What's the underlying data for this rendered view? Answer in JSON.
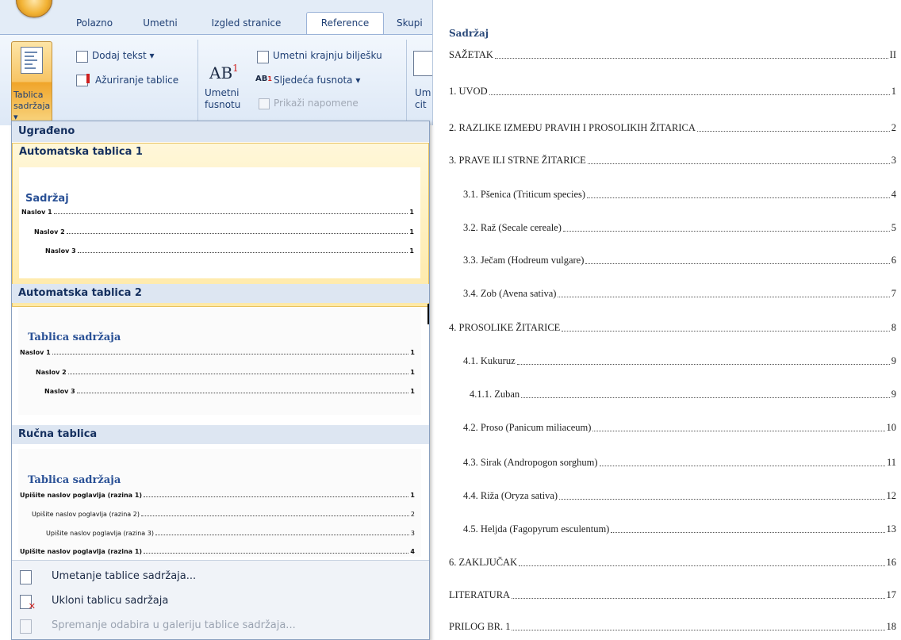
{
  "ribbon": {
    "tabs": [
      "Polazno",
      "Umetni",
      "Izgled stranice",
      "Reference",
      "Skupi"
    ],
    "active_tab": "Reference",
    "toc_button": {
      "line1": "Tablica",
      "line2": "sadržaja ▾"
    },
    "add_text": "Dodaj tekst ▾",
    "update_table": "Ažuriranje tablice",
    "insert_endnote": "Umetni krajnju bilješku",
    "next_footnote": "Sljedeća fusnota ▾",
    "show_notes": "Prikaži napomene",
    "insert_footnote": {
      "line1": "Umetni",
      "line2": "fusnotu"
    },
    "insert_citation": {
      "line1": "Um",
      "line2": "cit"
    },
    "ab_glyph": "AB",
    "ab_sup": "1"
  },
  "dropdown": {
    "builtin_header": "Ugrađeno",
    "items": [
      {
        "name": "Automatska tablica 1",
        "preview_title": "Sadržaj",
        "rows": [
          {
            "text": "Naslov 1",
            "page": "1"
          },
          {
            "text": "Naslov 2",
            "page": "1"
          },
          {
            "text": "Naslov 3",
            "page": "1"
          }
        ]
      },
      {
        "name": "Automatska tablica 2",
        "preview_title": "Tablica sadržaja",
        "rows": [
          {
            "text": "Naslov 1",
            "page": "1"
          },
          {
            "text": "Naslov 2",
            "page": "1"
          },
          {
            "text": "Naslov 3",
            "page": "1"
          }
        ]
      },
      {
        "name": "Ručna tablica",
        "preview_title": "Tablica sadržaja",
        "rows": [
          {
            "text": "Upišite naslov poglavlja (razina 1)",
            "page": "1"
          },
          {
            "text": "Upišite naslov poglavlja (razina 2)",
            "page": "2"
          },
          {
            "text": "Upišite naslov poglavlja (razina 3)",
            "page": "3"
          },
          {
            "text": "Upišite naslov poglavlja (razina 1)",
            "page": "4"
          }
        ]
      }
    ],
    "menu": [
      {
        "label": "Umetanje tablice sadržaja...",
        "enabled": true
      },
      {
        "label": "Ukloni tablicu sadržaja",
        "enabled": true
      },
      {
        "label": "Spremanje odabira u galeriju tablice sadržaja...",
        "enabled": false
      }
    ]
  },
  "document": {
    "title": "Sadržaj",
    "entries": [
      {
        "text": "SAŽETAK",
        "page": "II"
      },
      {
        "text": "1. UVOD",
        "page": "1"
      },
      {
        "text": "2. RAZLIKE IZMEĐU PRAVIH I PROSOLIKIH ŽITARICA",
        "page": "2"
      },
      {
        "text": "3. PRAVE ILI STRNE ŽITARICE",
        "page": "3"
      },
      {
        "text": "3.1. Pšenica  (Triticum species)",
        "page": "4"
      },
      {
        "text": "3.2. Raž (Secale cereale)",
        "page": "5"
      },
      {
        "text": "3.3. Ječam (Hodreum vulgare)",
        "page": "6"
      },
      {
        "text": "3.4. Zob (Avena sativa)",
        "page": "7"
      },
      {
        "text": "4. PROSOLIKE ŽITARICE",
        "page": "8"
      },
      {
        "text": "4.1. Kukuruz",
        "page": "9"
      },
      {
        "text": "4.1.1. Zuban",
        "page": "9"
      },
      {
        "text": "4.2. Proso (Panicum miliaceum)",
        "page": "10"
      },
      {
        "text": "4.3. Sirak (Andropogon sorghum)",
        "page": "11"
      },
      {
        "text": "4.4. Riža (Oryza sativa)",
        "page": "12"
      },
      {
        "text": "4.5. Heljda (Fagopyrum esculentum)",
        "page": "13"
      },
      {
        "text": "6. ZAKLJUČAK",
        "page": "16"
      },
      {
        "text": "LITERATURA",
        "page": "17"
      },
      {
        "text": "PRILOG BR. 1",
        "page": "18"
      }
    ]
  }
}
